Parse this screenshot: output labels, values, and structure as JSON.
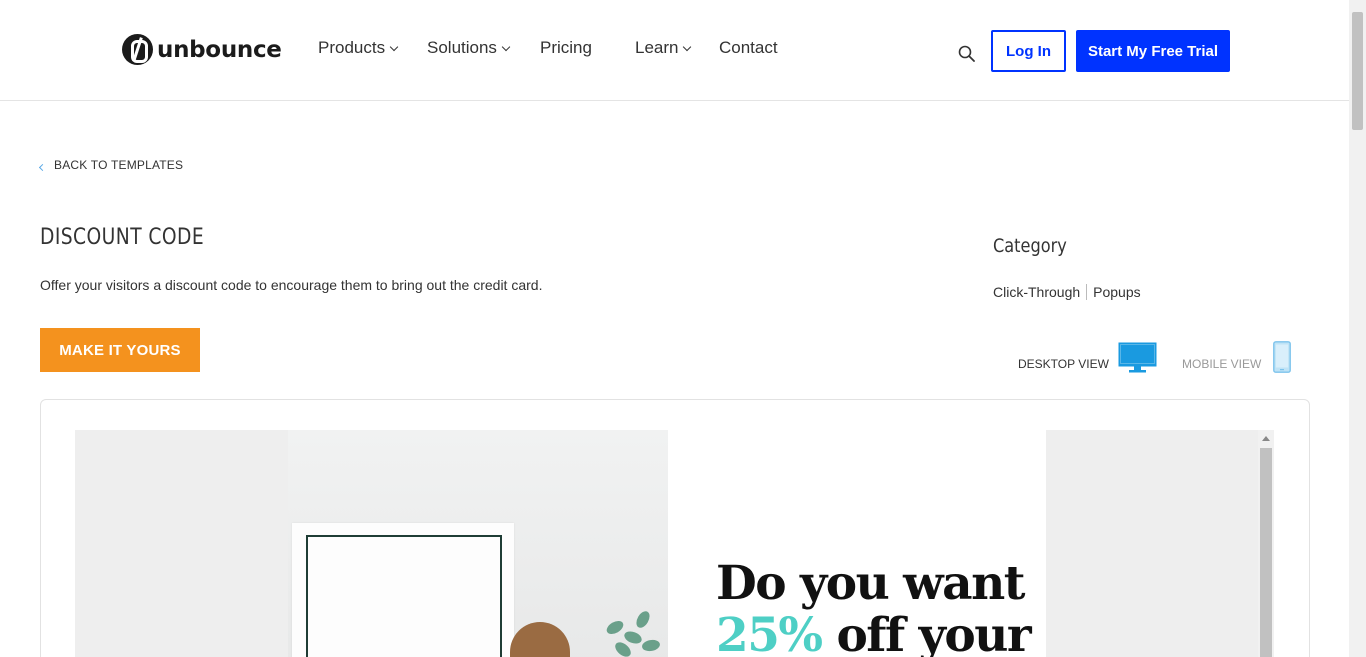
{
  "header": {
    "logo_text": "unbounce",
    "nav": [
      {
        "label": "Products"
      },
      {
        "label": "Solutions"
      },
      {
        "label": "Pricing"
      },
      {
        "label": "Learn"
      },
      {
        "label": "Contact"
      }
    ],
    "login_label": "Log In",
    "trial_label": "Start My Free Trial"
  },
  "back_link": "BACK TO TEMPLATES",
  "template": {
    "title": "DISCOUNT CODE",
    "description": "Offer your visitors a discount code to encourage them to bring out the credit card.",
    "cta_label": "MAKE IT YOURS"
  },
  "category": {
    "title": "Category",
    "items": [
      "Click-Through",
      "Popups"
    ]
  },
  "views": {
    "desktop_label": "DESKTOP VIEW",
    "mobile_label": "MOBILE VIEW",
    "active": "desktop"
  },
  "preview": {
    "headline_line1": "Do you want",
    "headline_accent": "25%",
    "headline_line2_rest": " off your"
  },
  "colors": {
    "brand_blue": "#0033ff",
    "cta_orange": "#f4921e",
    "accent_teal": "#4ecfc5",
    "icon_blue": "#1a9ae0"
  }
}
